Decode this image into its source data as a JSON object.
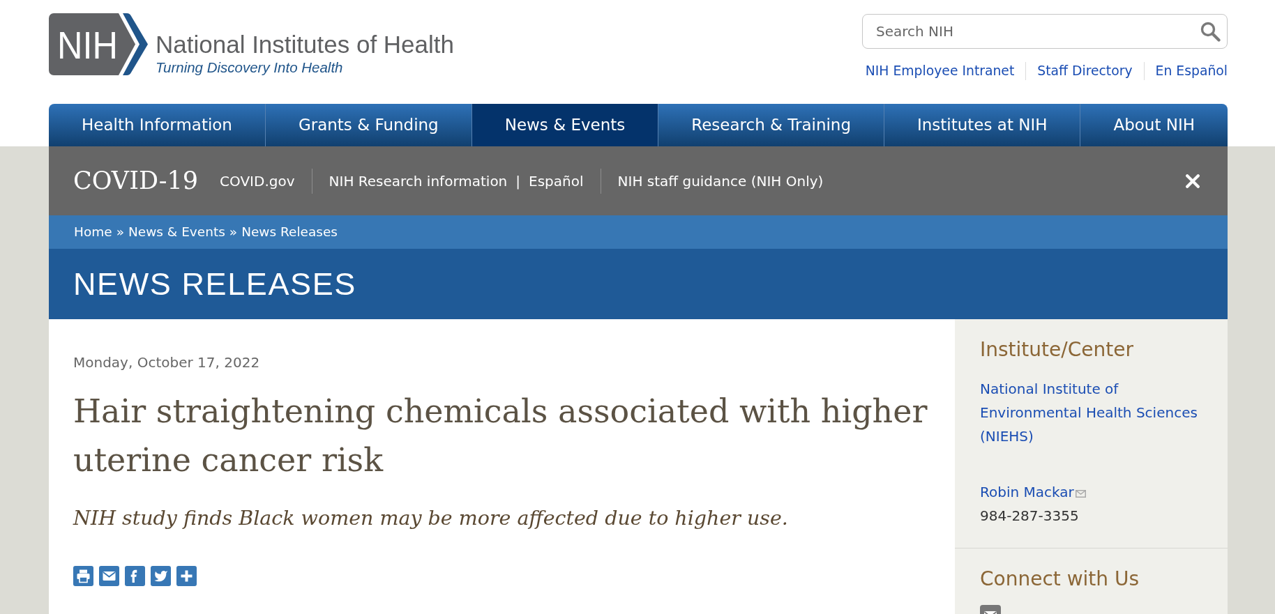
{
  "header": {
    "logo": {
      "mark": "NIH",
      "name": "National Institutes of Health",
      "tagline": "Turning Discovery Into Health"
    },
    "search": {
      "placeholder": "Search NIH"
    },
    "utility_links": [
      "NIH Employee Intranet",
      "Staff Directory",
      "En Español"
    ]
  },
  "main_nav": [
    {
      "label": "Health Information",
      "selected": false
    },
    {
      "label": "Grants & Funding",
      "selected": false
    },
    {
      "label": "News & Events",
      "selected": true
    },
    {
      "label": "Research & Training",
      "selected": false
    },
    {
      "label": "Institutes at NIH",
      "selected": false
    },
    {
      "label": "About NIH",
      "selected": false
    }
  ],
  "covid_banner": {
    "title": "COVID-19",
    "inline_separator": "|",
    "link_groups": [
      [
        "COVID.gov"
      ],
      [
        "NIH Research information",
        "Español"
      ],
      [
        "NIH staff guidance (NIH Only)"
      ]
    ]
  },
  "breadcrumb": {
    "separator": "»",
    "items": [
      "Home",
      "News & Events",
      "News Releases"
    ]
  },
  "section_title": "NEWS RELEASES",
  "article": {
    "date": "Monday, October 17, 2022",
    "title": "Hair straightening chemicals associated with higher uterine cancer risk",
    "subtitle": "NIH study finds Black women may be more affected due to higher use."
  },
  "sidebar": [
    {
      "kind": "contact",
      "heading": "Institute/Center",
      "link": "National Institute of Environmental Health Sciences (NIEHS)",
      "contact": {
        "name": "Robin Mackar",
        "phone": "984-287-3355"
      }
    },
    {
      "kind": "connect",
      "heading": "Connect with Us"
    }
  ]
}
